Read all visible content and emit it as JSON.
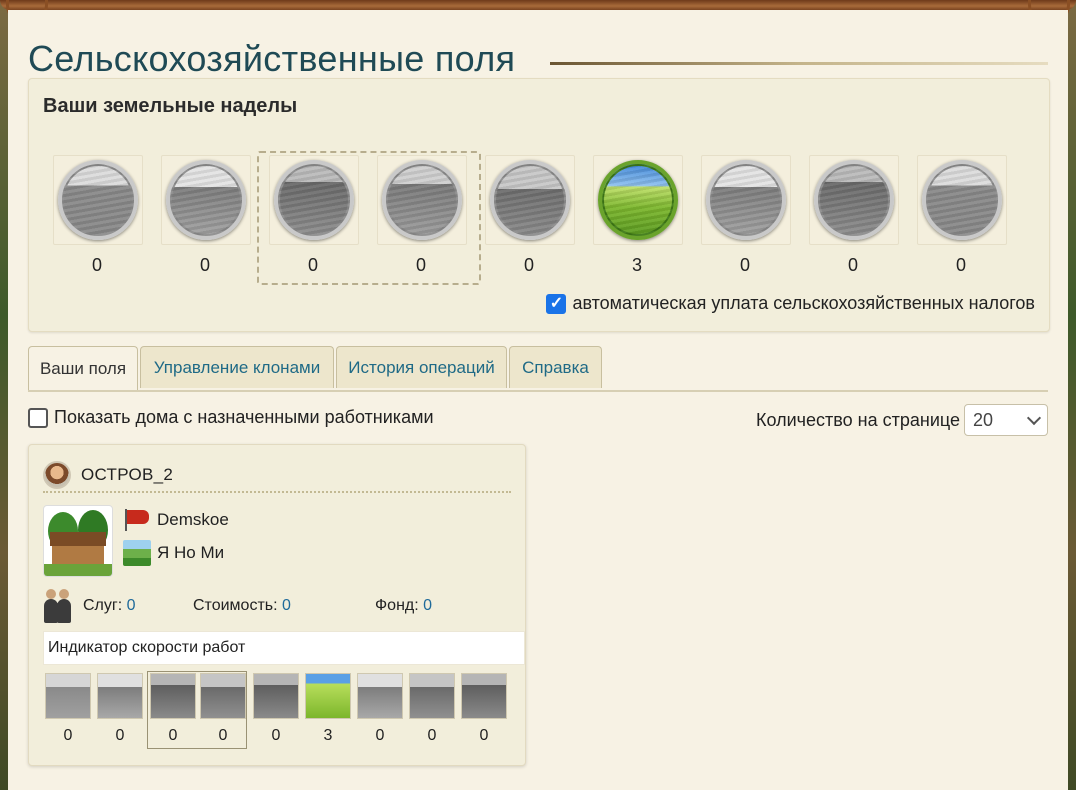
{
  "page_title": "Сельскохозяйственные поля",
  "plots": {
    "heading": "Ваши земельные наделы",
    "items": [
      {
        "count": "0",
        "icon": "plowed-field-icon"
      },
      {
        "count": "0",
        "icon": "furrowed-field-icon"
      },
      {
        "count": "0",
        "icon": "planting-workers-icon"
      },
      {
        "count": "0",
        "icon": "sowing-field-icon"
      },
      {
        "count": "0",
        "icon": "farmers-field-icon"
      },
      {
        "count": "3",
        "icon": "green-field-icon"
      },
      {
        "count": "0",
        "icon": "grain-field-icon"
      },
      {
        "count": "0",
        "icon": "harvest-worker-icon"
      },
      {
        "count": "0",
        "icon": "harvested-field-icon"
      }
    ],
    "auto_tax_label": "автоматическая уплата сельскохозяйственных налогов",
    "auto_tax_checked": true
  },
  "tabs": [
    {
      "label": "Ваши поля",
      "active": true
    },
    {
      "label": "Управление клонами",
      "active": false
    },
    {
      "label": "История операций",
      "active": false
    },
    {
      "label": "Справка",
      "active": false
    }
  ],
  "filters": {
    "show_houses_label": "Показать дома с назначенными работниками",
    "show_houses_checked": false,
    "per_page_label": "Количество на странице",
    "per_page_value": "20"
  },
  "card": {
    "title": "ОСТРОВ_2",
    "owner": "Demskoe",
    "location": "Я Но Ми",
    "servants_label": "Слуг:",
    "servants_value": "0",
    "cost_label": "Стоимость:",
    "cost_value": "0",
    "fund_label": "Фонд:",
    "fund_value": "0",
    "speed_label": "Индикатор скорости работ",
    "mini": [
      "0",
      "0",
      "0",
      "0",
      "0",
      "3",
      "0",
      "0",
      "0"
    ]
  },
  "colors": {
    "accent_blue": "#1f6a86",
    "checkbox_blue": "#1a73e8",
    "value_blue": "#1f6a9a"
  }
}
